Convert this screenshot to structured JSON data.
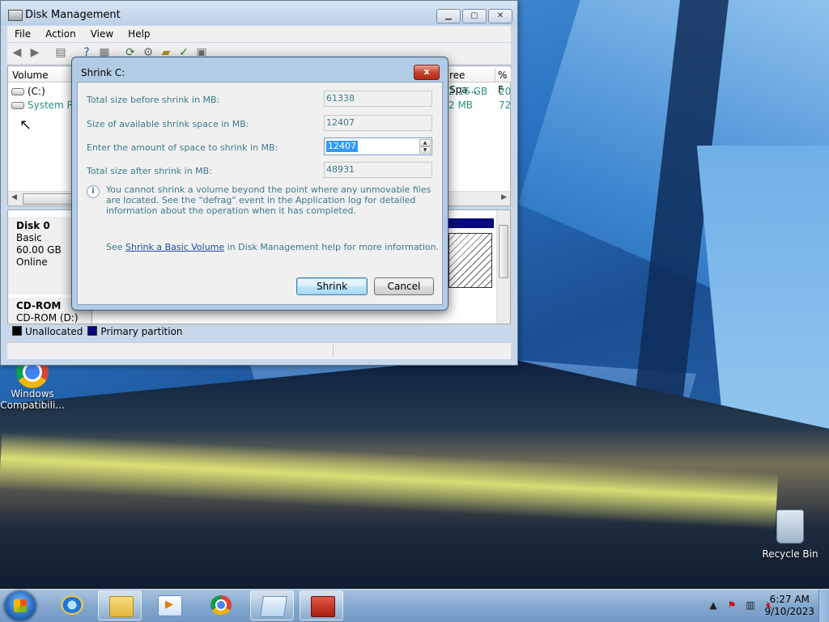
{
  "desktop": {
    "icons": [
      {
        "label_line1": "Windows",
        "label_line2": "Compatibili..."
      },
      {
        "label_line1": "Recycle Bin"
      }
    ]
  },
  "window": {
    "title": "Disk Management",
    "menu": [
      "File",
      "Action",
      "View",
      "Help"
    ],
    "columns": {
      "volume": "Volume",
      "free_space": "ree Spa...",
      "percent_free": "% F"
    },
    "volumes": [
      {
        "name": "(C:)",
        "free": "2.16 GB",
        "pct": "20"
      },
      {
        "name": "System Res",
        "free": "2 MB",
        "pct": "72"
      }
    ],
    "disks": [
      {
        "name": "Disk 0",
        "type": "Basic",
        "size": "60.00 GB",
        "status": "Online"
      },
      {
        "name": "CD-ROM",
        "detail": "CD-ROM (D:)"
      }
    ],
    "legend": {
      "unallocated": "Unallocated",
      "primary": "Primary partition"
    }
  },
  "dialog": {
    "title": "Shrink C:",
    "close": "x",
    "fields": {
      "total_before_label": "Total size before shrink in MB:",
      "total_before_value": "61338",
      "available_label": "Size of available shrink space in MB:",
      "available_value": "12407",
      "amount_label": "Enter the amount of space to shrink in MB:",
      "amount_value": "12407",
      "total_after_label": "Total size after shrink in MB:",
      "total_after_value": "48931"
    },
    "info": "You cannot shrink a volume beyond the point where any unmovable files are located. See the \"defrag\" event in the Application log for detailed information about the operation when it has completed.",
    "see": {
      "prefix": "See ",
      "link": "Shrink a Basic Volume",
      "suffix": " in Disk Management help for more information."
    },
    "buttons": {
      "shrink": "Shrink",
      "cancel": "Cancel"
    }
  },
  "taskbar": {
    "clock": {
      "time": "6:27 AM",
      "date": "9/10/2023"
    }
  },
  "colors": {
    "accent": "#3399ff",
    "primary_partition": "#0a0a80",
    "unallocated": "#000000"
  }
}
